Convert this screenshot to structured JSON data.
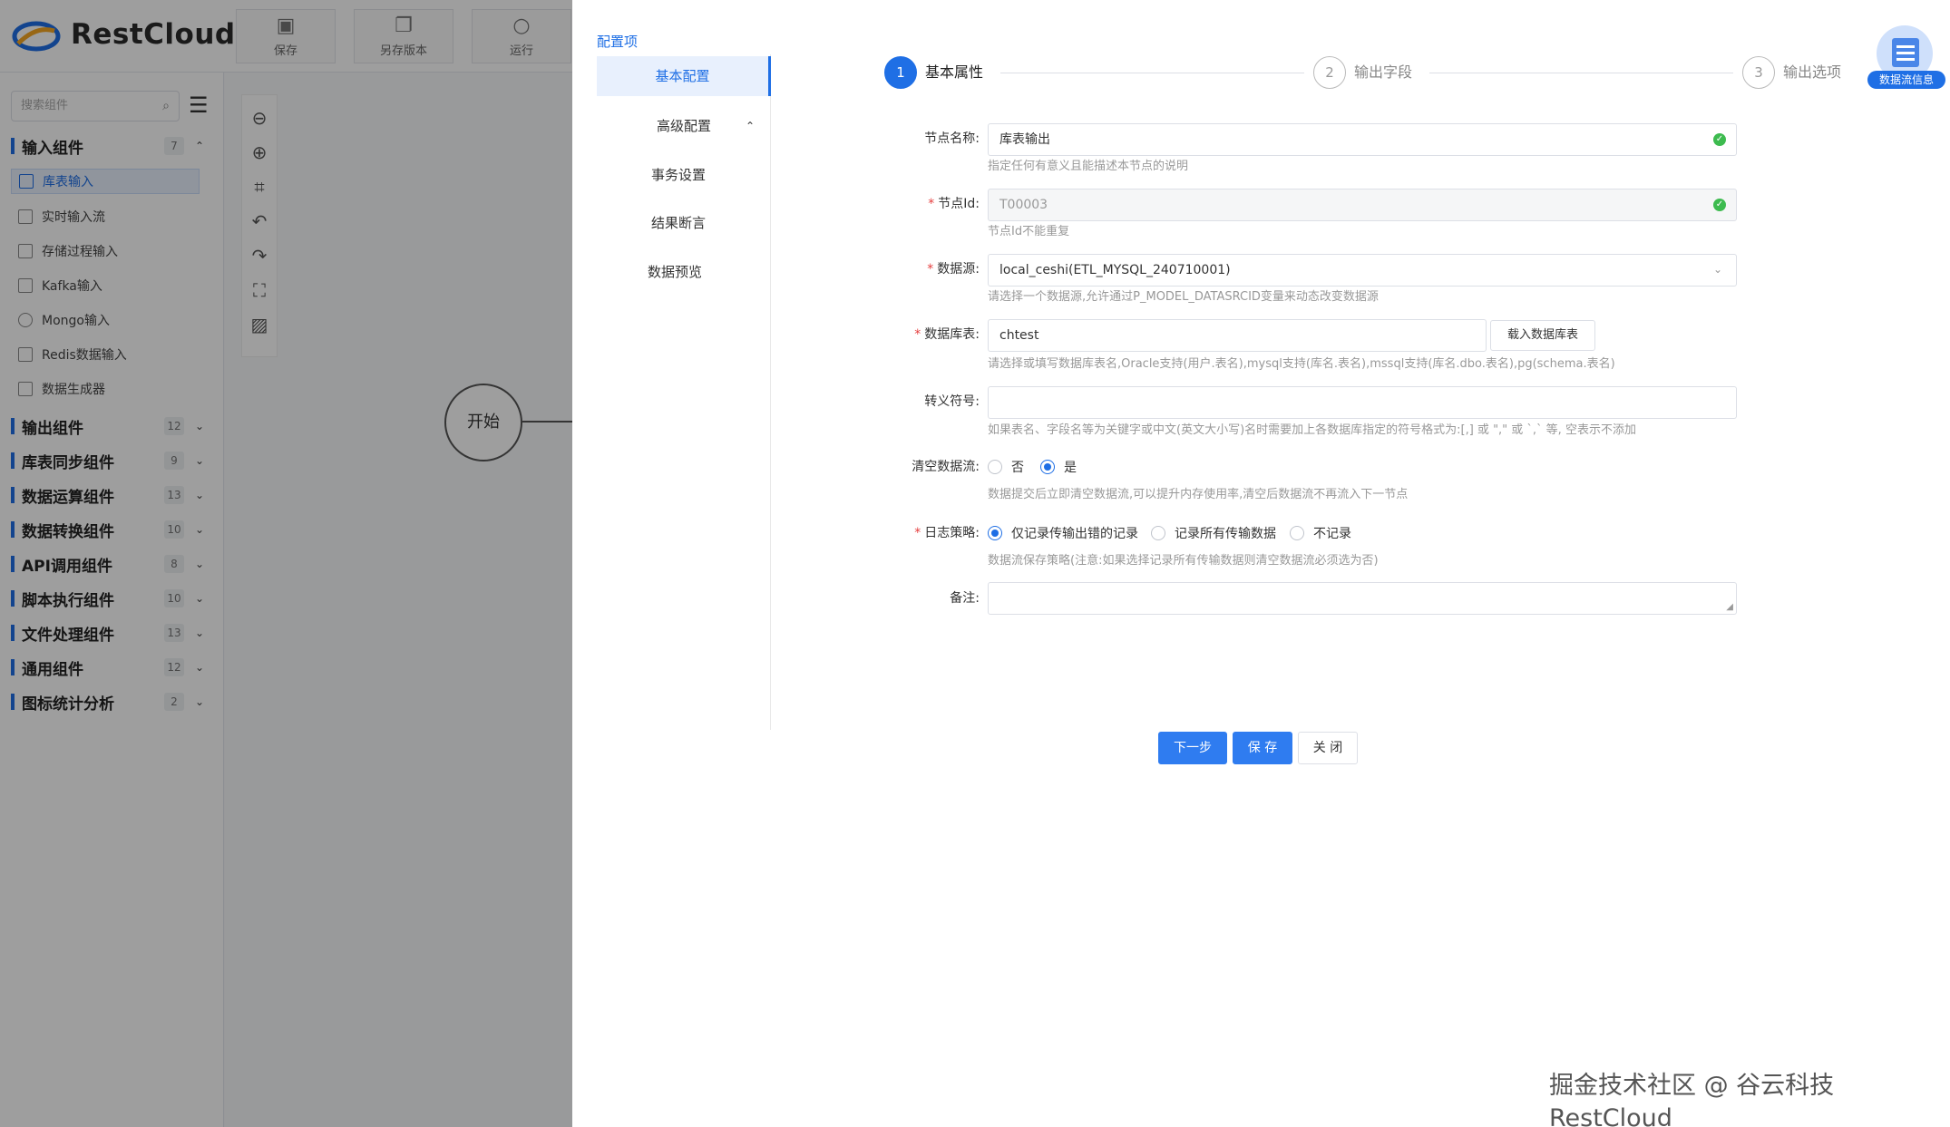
{
  "app": {
    "brand": "RestCloud",
    "toolbar": [
      {
        "label": "保存",
        "icon": "save-icon"
      },
      {
        "label": "另存版本",
        "icon": "save-version-icon"
      },
      {
        "label": "运行",
        "icon": "run-icon"
      }
    ]
  },
  "sidebar": {
    "search_placeholder": "搜索组件",
    "groups": [
      {
        "label": "输入组件",
        "count": "7",
        "expanded": true
      },
      {
        "label": "输出组件",
        "count": "12"
      },
      {
        "label": "库表同步组件",
        "count": "9"
      },
      {
        "label": "数据运算组件",
        "count": "13"
      },
      {
        "label": "数据转换组件",
        "count": "10"
      },
      {
        "label": "API调用组件",
        "count": "8"
      },
      {
        "label": "脚本执行组件",
        "count": "10"
      },
      {
        "label": "文件处理组件",
        "count": "13"
      },
      {
        "label": "通用组件",
        "count": "12"
      },
      {
        "label": "图标统计分析",
        "count": "2"
      }
    ],
    "input_items": [
      "库表输入",
      "实时输入流",
      "存储过程输入",
      "Kafka输入",
      "Mongo输入",
      "Redis数据输入",
      "数据生成器"
    ],
    "active_item": "库表输入"
  },
  "canvas": {
    "start_node": "开始"
  },
  "drawer": {
    "config_title": "配置项",
    "nav": {
      "basic": "基本配置",
      "advanced": "高级配置",
      "transaction": "事务设置",
      "assertion": "结果断言",
      "preview": "数据预览"
    },
    "steps": [
      {
        "num": "1",
        "label": "基本属性"
      },
      {
        "num": "2",
        "label": "输出字段"
      },
      {
        "num": "3",
        "label": "输出选项"
      }
    ],
    "flow_info": "数据流信息",
    "form": {
      "node_name": {
        "label": "节点名称:",
        "value": "库表输出",
        "help": "指定任何有意义且能描述本节点的说明"
      },
      "node_id": {
        "label": "节点Id:",
        "value": "T00003",
        "help": "节点Id不能重复"
      },
      "datasource": {
        "label": "数据源:",
        "value": "local_ceshi(ETL_MYSQL_240710001)",
        "help": "请选择一个数据源,允许通过P_MODEL_DATASRCID变量来动态改变数据源"
      },
      "table": {
        "label": "数据库表:",
        "value": "chtest",
        "button": "载入数据库表",
        "help": "请选择或填写数据库表名,Oracle支持(用户.表名),mysql支持(库名.表名),mssql支持(库名.dbo.表名),pg(schema.表名)"
      },
      "escape": {
        "label": "转义符号:",
        "value": "",
        "help": "如果表名、字段名等为关键字或中文(英文大小写)名时需要加上各数据库指定的符号格式为:[,] 或 \",\" 或 `,` 等, 空表示不添加"
      },
      "clear_flow": {
        "label": "清空数据流:",
        "options": [
          "否",
          "是"
        ],
        "selected": "是",
        "help": "数据提交后立即清空数据流,可以提升内存使用率,清空后数据流不再流入下一节点"
      },
      "log_policy": {
        "label": "日志策略:",
        "options": [
          "仅记录传输出错的记录",
          "记录所有传输数据",
          "不记录"
        ],
        "selected": "仅记录传输出错的记录",
        "help": "数据流保存策略(注意:如果选择记录所有传输数据则清空数据流必须选为否)"
      },
      "remark": {
        "label": "备注:",
        "value": ""
      }
    },
    "actions": {
      "next": "下一步",
      "save": "保 存",
      "close": "关 闭"
    }
  },
  "watermark": "掘金技术社区 @ 谷云科技RestCloud",
  "colors": {
    "primary": "#1f6fe5",
    "success": "#3dbb4f",
    "required": "#e53e3e"
  }
}
